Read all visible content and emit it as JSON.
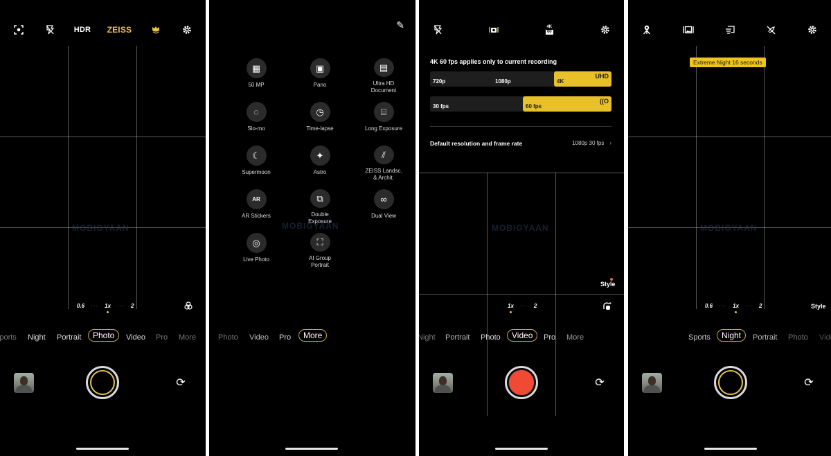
{
  "screens": [
    {
      "id": "photo",
      "topbar": {
        "icons": [
          "focus-icon",
          "flash-off-icon"
        ],
        "hdr_label": "HDR",
        "zeiss_label": "ZEISS",
        "right_icons": [
          "portrait-effect-icon",
          "settings-icon"
        ]
      },
      "zoom_levels": [
        "0.6",
        "1x",
        "2"
      ],
      "active_zoom": "1x",
      "watermark": "MOBIGYAAN",
      "modes": [
        "Sports",
        "Night",
        "Portrait",
        "Photo",
        "Video",
        "Pro",
        "More"
      ],
      "selected_mode": "Photo"
    },
    {
      "id": "more",
      "more_modes": [
        {
          "label": "50 MP",
          "icon": "grid-icon"
        },
        {
          "label": "Pano",
          "icon": "panorama-icon"
        },
        {
          "label": "Ultra HD Document",
          "icon": "document-icon"
        },
        {
          "label": "Slo-mo",
          "icon": "slow-motion-icon"
        },
        {
          "label": "Time-lapse",
          "icon": "timer-icon"
        },
        {
          "label": "Long Exposure",
          "icon": "long-exposure-icon"
        },
        {
          "label": "Supermoon",
          "icon": "moon-icon"
        },
        {
          "label": "Astro",
          "icon": "stars-icon"
        },
        {
          "label": "ZEISS Landsc. & Archit.",
          "icon": "landscape-icon"
        },
        {
          "label": "AR Stickers",
          "icon": "ar-icon"
        },
        {
          "label": "Double Exposure",
          "icon": "double-exposure-icon"
        },
        {
          "label": "Dual View",
          "icon": "dual-view-icon"
        },
        {
          "label": "Live Photo",
          "icon": "live-photo-icon"
        },
        {
          "label": "AI Group Portrait",
          "icon": "group-portrait-icon"
        }
      ],
      "watermark": "MOBIGYAAN",
      "modes": [
        "Photo",
        "Video",
        "Pro",
        "More"
      ],
      "selected_mode": "More"
    },
    {
      "id": "video",
      "topbar": {
        "icons": [
          "flash-off-icon",
          "stabilization-icon",
          "resolution-icon",
          "settings-icon"
        ],
        "res_top": "4K",
        "res_bottom": "60"
      },
      "panel": {
        "title": "4K 60 fps applies only to current recording",
        "resolutions": [
          "720p",
          "1080p",
          "4K"
        ],
        "selected_resolution": "4K",
        "resolution_badge": "UHD",
        "framerates": [
          "30 fps",
          "60 fps"
        ],
        "selected_framerate": "60 fps",
        "framerate_badge": "((O",
        "default_label": "Default resolution and frame rate",
        "default_value": "1080p 30 fps"
      },
      "style_label": "Style",
      "zoom_levels": [
        "1x",
        "2"
      ],
      "active_zoom": "1x",
      "watermark": "MOBIGYAAN",
      "modes": [
        "Night",
        "Portrait",
        "Photo",
        "Video",
        "Pro",
        "More"
      ],
      "selected_mode": "Video"
    },
    {
      "id": "night",
      "topbar": {
        "icons": [
          "tripod-icon",
          "panorama-icon",
          "long-exposure-icon",
          "night-filter-icon",
          "settings-icon"
        ]
      },
      "tooltip": "Extreme Night 16 seconds",
      "style_label": "Style",
      "zoom_levels": [
        "0.6",
        "1x",
        "2"
      ],
      "active_zoom": "1x",
      "watermark": "MOBIGYAAN",
      "modes": [
        "Sports",
        "Night",
        "Portrait",
        "Photo",
        "Video"
      ],
      "selected_mode": "Night"
    }
  ],
  "colors": {
    "accent": "#e8c547",
    "record": "#f04a35",
    "highlight": "#e8c02a"
  }
}
